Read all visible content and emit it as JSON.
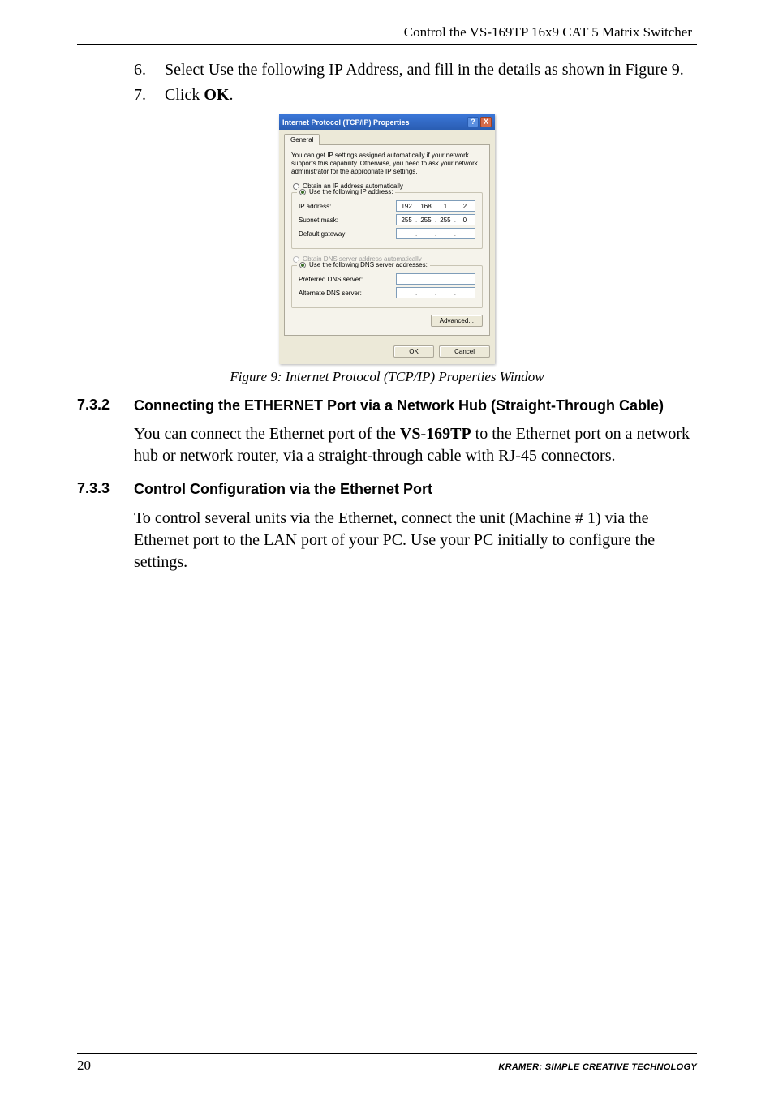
{
  "header": {
    "title": "Control the VS-169TP 16x9 CAT 5 Matrix Switcher"
  },
  "list": {
    "item6": {
      "num": "6.",
      "text": "Select Use the following IP Address, and fill in the details as shown in Figure 9."
    },
    "item7": {
      "num": "7.",
      "text_pre": "Click ",
      "bold": "OK",
      "text_post": "."
    }
  },
  "dialog": {
    "title": "Internet Protocol (TCP/IP) Properties",
    "help_icon": "?",
    "close_icon": "X",
    "tab": "General",
    "description": "You can get IP settings assigned automatically if your network supports this capability. Otherwise, you need to ask your network administrator for the appropriate IP settings.",
    "radio_auto_ip": "Obtain an IP address automatically",
    "radio_use_ip": "Use the following IP address:",
    "label_ip": "IP address:",
    "label_subnet": "Subnet mask:",
    "label_gateway": "Default gateway:",
    "ip": {
      "a": "192",
      "b": "168",
      "c": "1",
      "d": "2"
    },
    "subnet": {
      "a": "255",
      "b": "255",
      "c": "255",
      "d": "0"
    },
    "gateway": {
      "a": "",
      "b": "",
      "c": "",
      "d": ""
    },
    "radio_auto_dns": "Obtain DNS server address automatically",
    "radio_use_dns": "Use the following DNS server addresses:",
    "label_pref_dns": "Preferred DNS server:",
    "label_alt_dns": "Alternate DNS server:",
    "pref_dns": {
      "a": "",
      "b": "",
      "c": "",
      "d": ""
    },
    "alt_dns": {
      "a": "",
      "b": "",
      "c": "",
      "d": ""
    },
    "btn_advanced": "Advanced...",
    "btn_ok": "OK",
    "btn_cancel": "Cancel"
  },
  "figure_caption": "Figure 9: Internet Protocol (TCP/IP) Properties Window",
  "section_732": {
    "num": "7.3.2",
    "title": "Connecting the ETHERNET Port via a Network Hub (Straight-Through Cable)",
    "para_pre": "You can connect the Ethernet port of the ",
    "para_bold": "VS-169TP",
    "para_post": " to the Ethernet port on a network hub or network router, via a straight-through cable with RJ-45 connectors."
  },
  "section_733": {
    "num": "7.3.3",
    "title": "Control Configuration via the Ethernet Port",
    "para": "To control several units via the Ethernet, connect the unit (Machine # 1) via the Ethernet port to the LAN port of your PC. Use your PC initially to configure the settings."
  },
  "footer": {
    "page": "20",
    "brand": "KRAMER:  SIMPLE CREATIVE TECHNOLOGY"
  },
  "dot": "."
}
